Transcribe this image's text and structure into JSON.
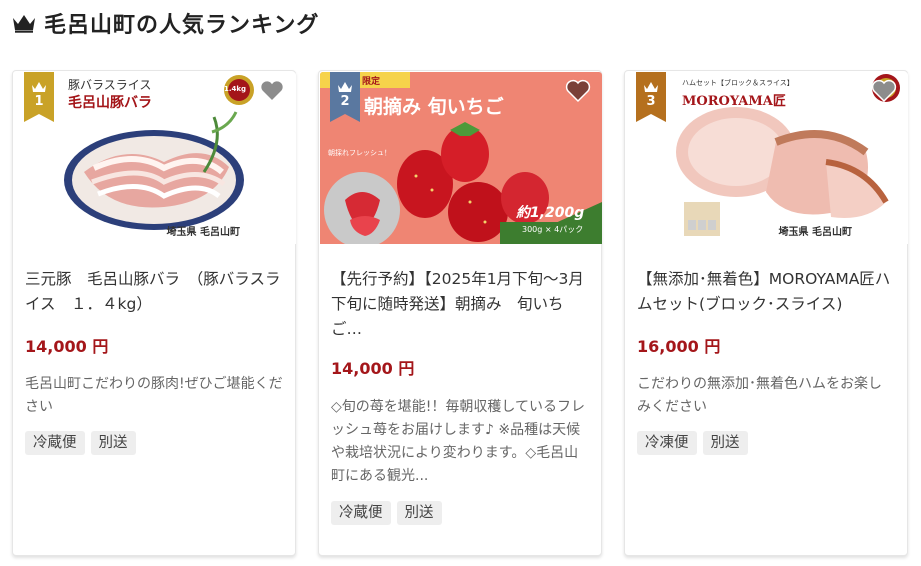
{
  "header": {
    "title": "毛呂山町の人気ランキング",
    "icon": "crown-icon",
    "icon_color": "#222222"
  },
  "accent": {
    "price_color": "#a4161a",
    "rank_colors": [
      "#c9a227",
      "#5a78a0",
      "#b5701e"
    ]
  },
  "cards": [
    {
      "rank": "1",
      "image_text": {
        "line1": "豚バラスライス",
        "line2": "毛呂山豚バラ",
        "badge": "1.4kg",
        "footer": "埼玉県 毛呂山町"
      },
      "name": "三元豚　毛呂山豚バラ　（豚バラスライス　１．４kg）",
      "price": "14,000 円",
      "description": "毛呂山町こだわりの豚肉!ぜひご堪能ください",
      "tags": [
        "冷蔵便",
        "別送"
      ]
    },
    {
      "rank": "2",
      "image_text": {
        "limited": "限定",
        "headline": "朝摘み 旬いちご",
        "fresh": "朝採れフレッシュ！",
        "amount": "約1,200g",
        "sub": "300g × 4パック"
      },
      "name": "【先行予約】【2025年1月下旬～3月下旬に随時発送】朝摘み　旬いちご…",
      "price": "14,000 円",
      "description": "◇旬の苺を堪能!！毎朝収穫しているフレッシュ苺をお届けします♪ ※品種は天候や栽培状況により変わります。◇毛呂山町にある観光...",
      "tags": [
        "冷蔵便",
        "別送"
      ]
    },
    {
      "rank": "3",
      "image_text": {
        "small": "ハムセット【ブロック＆スライス】",
        "brand": "MOROYAMA匠",
        "footer": "埼玉県 毛呂山町"
      },
      "name": "【無添加･無着色】MOROYAMA匠ハムセット(ブロック･スライス)",
      "price": "16,000 円",
      "description": "こだわりの無添加･無着色ハムをお楽しみください",
      "tags": [
        "冷凍便",
        "別送"
      ]
    }
  ]
}
